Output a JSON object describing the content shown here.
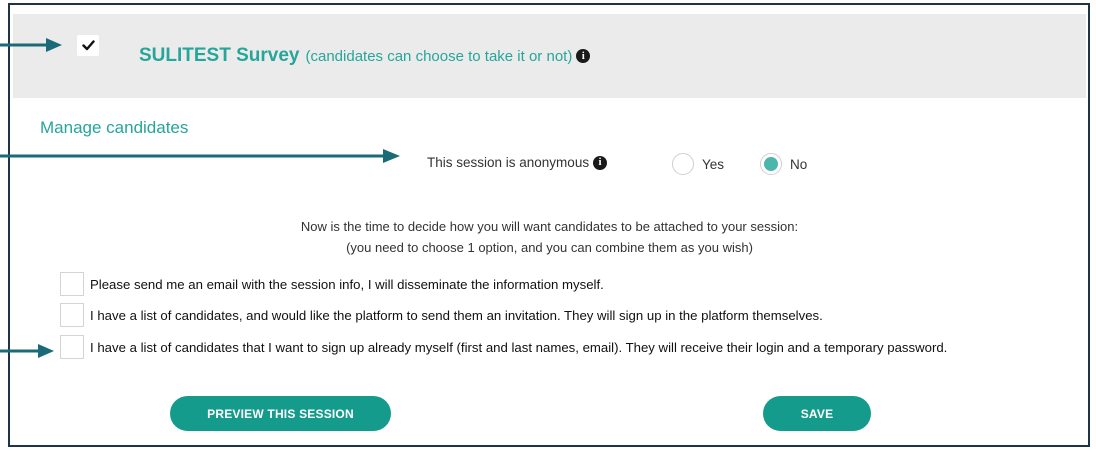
{
  "survey": {
    "checked": true,
    "title": "SULITEST Survey",
    "subtitle": "(candidates can choose to take it or not)"
  },
  "manage": {
    "heading": "Manage candidates",
    "anonymous_label": "This session is anonymous",
    "options": {
      "yes": {
        "label": "Yes",
        "selected": false
      },
      "no": {
        "label": "No",
        "selected": true
      }
    }
  },
  "instructions": {
    "line1": "Now is the time to decide how you will want candidates to be attached to your session:",
    "line2": "(you need to choose 1 option, and you can combine them as you wish)"
  },
  "attach_options": [
    {
      "label": "Please send me an email with the session info, I will disseminate the information myself.",
      "checked": false
    },
    {
      "label": "I have a list of candidates, and would like the platform to send them an invitation. They will sign up in the platform themselves.",
      "checked": false
    },
    {
      "label": "I have a list of candidates that I want to sign up already myself (first and last names, email). They will receive their login and a temporary password.",
      "checked": false
    }
  ],
  "actions": {
    "preview_label": "PREVIEW THIS SESSION",
    "save_label": "SAVE"
  },
  "colors": {
    "accent": "#26a69a",
    "button": "#159b8c",
    "arrow": "#1a6b77",
    "frame": "#1f3446",
    "header_band": "#ebebeb"
  },
  "icons": {
    "survey_check": "checkmark-icon",
    "info": "info-circle-icon",
    "callout": "arrow-right-icon"
  }
}
